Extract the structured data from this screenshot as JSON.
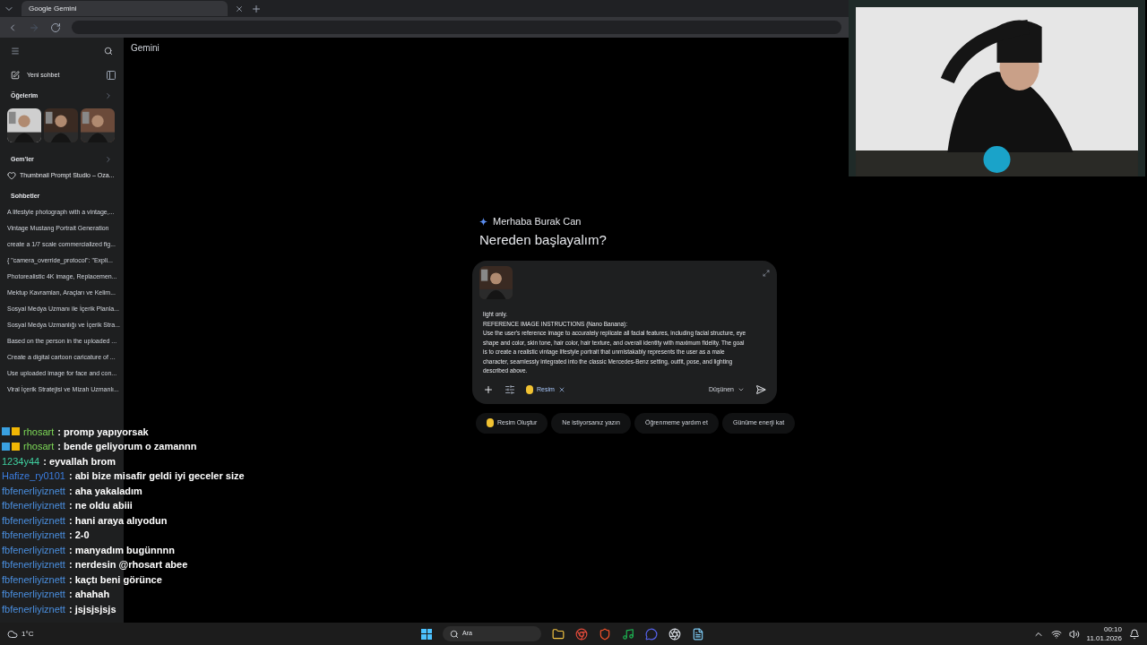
{
  "browser": {
    "tab": {
      "title": "Google Gemini"
    }
  },
  "app": {
    "title": "Gemini"
  },
  "sidebar": {
    "new_chat": "Yeni sohbet",
    "items_heading": "Öğelerim",
    "item_thumbnails": [
      {
        "kind": "picture"
      },
      {
        "kind": "picture"
      },
      {
        "kind": "picture"
      }
    ],
    "gems_heading": "Gem'ler",
    "gems": [
      "Thumbnail Prompt Studio – Oza..."
    ],
    "chats_heading": "Sohbetler",
    "chats": [
      "A lifestyle photograph with a vintage,...",
      "Vintage Mustang Portrait Generation",
      "create a 1/7 scale commercialized fig...",
      "{   \"camera_override_protocol\": \"Expli...",
      "Photorealistic 4K image, Replacemen...",
      "Mektup Kavramları, Araçları ve Kelim...",
      "Sosyal Medya Uzmanı ile İçerik Planla...",
      "Sosyal Medya Uzmanlığı ve İçerik Stra...",
      "Based on the person in the uploaded ...",
      "Create a digital cartoon caricature of ...",
      "Use uploaded image for face and con...",
      "Viral İçerik Stratejisi ve Mizah Uzmanlı..."
    ]
  },
  "greeting": {
    "hello": "Merhaba Burak Can",
    "question": "Nereden başlayalım?"
  },
  "composer": {
    "lines": [
      "light only.",
      "REFERENCE IMAGE INSTRUCTIONS (Nano Banana):",
      "Use the user's reference image to accurately replicate all facial features, including facial structure, eye shape and color, skin tone, hair color, hair texture, and overall identity with maximum fidelity. The goal is to create a realistic vintage lifestyle portrait that unmistakably represents the user as a male character, seamlessly integrated into the classic Mercedes-Benz setting, outfit, pose, and lighting described above."
    ],
    "tool_chip": "Resim",
    "mode": "Düşünen"
  },
  "suggestions": [
    "Resim Oluştur",
    "Ne istiyorsanız yazın",
    "Öğrenmeme yardım et",
    "Günüme enerji kat"
  ],
  "stream_chat": [
    {
      "user": "rhosart",
      "color": "#7ed957",
      "message": ": promp yapıyorsak",
      "badges": true
    },
    {
      "user": "rhosart",
      "color": "#7ed957",
      "message": ": bende geliyorum o zamannn",
      "badges": true
    },
    {
      "user": "1234y44",
      "color": "#3fcf9f",
      "message": ": eyvallah brom",
      "badges": false
    },
    {
      "user": "Hafize_ry0101",
      "color": "#3b7de0",
      "message": ": abi bize misafir geldi iyi geceler size",
      "badges": false
    },
    {
      "user": "fbfenerliyiznett",
      "color": "#4a8fe0",
      "message": ": aha yakaladım",
      "badges": false
    },
    {
      "user": "fbfenerliyiznett",
      "color": "#4a8fe0",
      "message": ": ne oldu abiii",
      "badges": false
    },
    {
      "user": "fbfenerliyiznett",
      "color": "#4a8fe0",
      "message": ": hani araya alıyodun",
      "badges": false
    },
    {
      "user": "fbfenerliyiznett",
      "color": "#4a8fe0",
      "message": ": 2-0",
      "badges": false
    },
    {
      "user": "fbfenerliyiznett",
      "color": "#4a8fe0",
      "message": ": manyadım bugünnnn",
      "badges": false
    },
    {
      "user": "fbfenerliyiznett",
      "color": "#4a8fe0",
      "message": ": nerdesin @rhosart abee",
      "badges": false
    },
    {
      "user": "fbfenerliyiznett",
      "color": "#4a8fe0",
      "message": ": kaçtı beni görünce",
      "badges": false
    },
    {
      "user": "fbfenerliyiznett",
      "color": "#4a8fe0",
      "message": ": ahahah",
      "badges": false
    },
    {
      "user": "fbfenerliyiznett",
      "color": "#4a8fe0",
      "message": ": jsjsjsjsjs",
      "badges": false
    }
  ],
  "taskbar": {
    "weather": "1°C",
    "search": "Ara",
    "time": "00:10",
    "date": "11.01.2026"
  }
}
